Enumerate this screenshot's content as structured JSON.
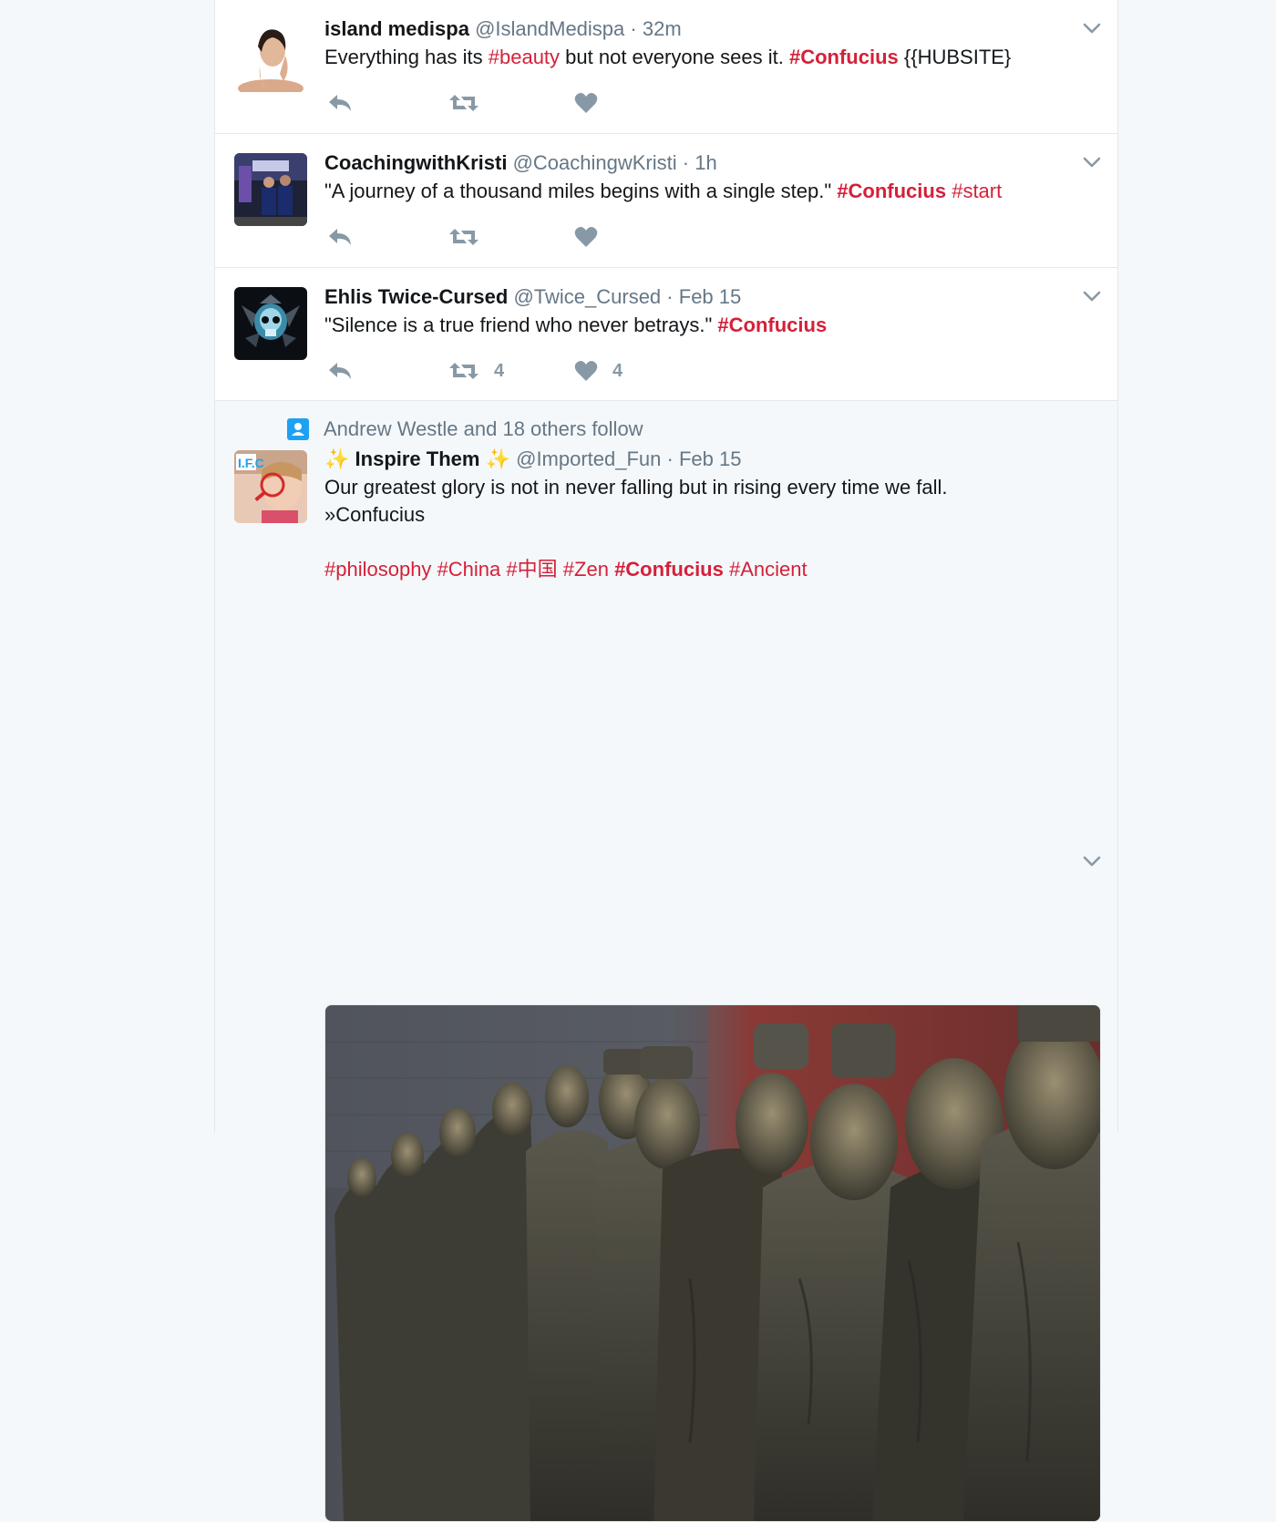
{
  "colors": {
    "hashtag": "#d4213a",
    "icon": "#8899a6",
    "accent": "#1da1f2"
  },
  "tweets": [
    {
      "name": "island medispa",
      "handle": "@IslandMedispa",
      "sep": "·",
      "time": "32m",
      "text": {
        "a": "Everything has its ",
        "tag1": "#beauty",
        "b": " but not everyone sees it. ",
        "tag2": "#Confucius",
        "c": " {{HUBSITE}"
      },
      "avatar_icon": "woman-portrait-avatar"
    },
    {
      "name": "CoachingwithKristi",
      "handle": "@CoachingwKristi",
      "sep": "·",
      "time": "1h",
      "text": {
        "a": "\"A journey of a thousand miles begins with a single step.\" ",
        "tag1": "#Confucius",
        "b": " ",
        "tag2": "#start"
      },
      "avatar_icon": "people-photo-avatar"
    },
    {
      "name": "Ehlis Twice-Cursed",
      "handle": "@Twice_Cursed",
      "sep": "·",
      "time": "Feb 15",
      "text": {
        "a": "\"Silence is a true friend who never betrays.\" ",
        "tag1": "#Confucius"
      },
      "retweet_count": "4",
      "like_count": "4",
      "avatar_icon": "skull-avatar"
    },
    {
      "social_context": "Andrew Westle and 18 others follow",
      "spark": "✨",
      "name": "Inspire Them",
      "handle": "@Imported_Fun",
      "sep": "·",
      "time": "Feb 15",
      "text": {
        "line1": "Our greatest glory is not in never falling but in rising every time we fall.",
        "line2": "»Confucius"
      },
      "tags": [
        "#philosophy",
        "#China",
        "#中国",
        "#Zen",
        "#Confucius",
        "#Ancient"
      ],
      "avatar_text": "I.F.C",
      "media_icon": "terracotta-statues-photo"
    }
  ]
}
